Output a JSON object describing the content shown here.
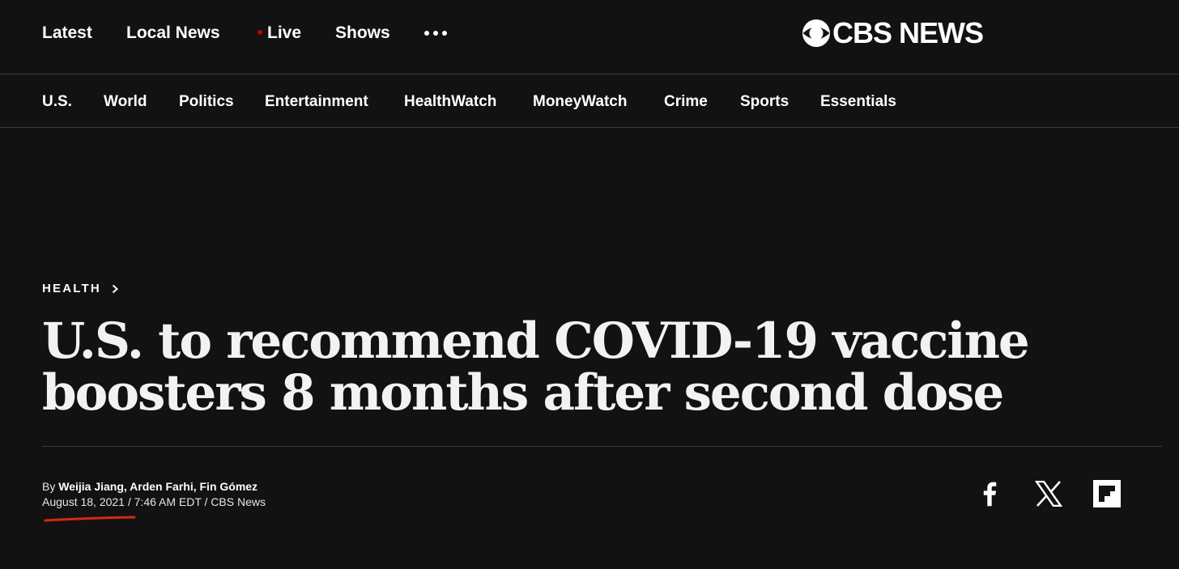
{
  "top_nav": {
    "items": [
      {
        "label": "Latest"
      },
      {
        "label": "Local News"
      },
      {
        "label": "Live"
      },
      {
        "label": "Shows"
      }
    ],
    "more_icon": "more-dots-icon",
    "logo_text": "CBS NEWS"
  },
  "section_nav": {
    "items": [
      {
        "label": "U.S."
      },
      {
        "label": "World"
      },
      {
        "label": "Politics"
      },
      {
        "label": "Entertainment"
      },
      {
        "label": "HealthWatch"
      },
      {
        "label": "MoneyWatch"
      },
      {
        "label": "Crime"
      },
      {
        "label": "Sports"
      },
      {
        "label": "Essentials"
      }
    ]
  },
  "article": {
    "section": "HEALTH",
    "headline_line1": "U.S. to recommend COVID-19 vaccine",
    "headline_line2": "boosters 8 months after second dose",
    "byline_prefix": "By ",
    "authors": "Weijia Jiang, Arden Farhi, Fin Gómez",
    "dateline": "August 18, 2021 / 7:46 AM EDT / CBS News"
  },
  "share": {
    "icons": [
      "facebook-icon",
      "x-icon",
      "flipboard-icon"
    ]
  },
  "colors": {
    "background": "#121212",
    "text": "#ffffff",
    "live_dot": "#c00000",
    "annotation_underline": "#d42a12",
    "divider": "#3a3a3a"
  }
}
